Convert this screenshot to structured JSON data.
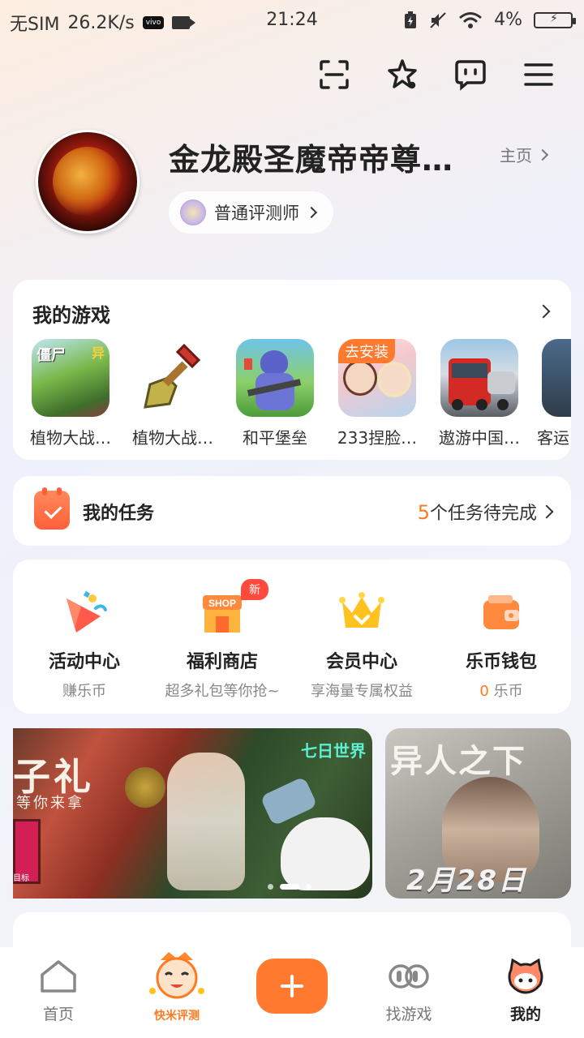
{
  "status_bar": {
    "carrier": "无SIM",
    "speed": "26.2K/s",
    "vivo": "vivo",
    "time": "21:24",
    "battery": "4%"
  },
  "top_icons": [
    "scan-icon",
    "star-icon",
    "message-icon",
    "menu-icon"
  ],
  "profile": {
    "username": "金龙殿圣魔帝帝尊…",
    "home_link": "主页",
    "badge": "普通评测师"
  },
  "my_games": {
    "title": "我的游戏",
    "install_tag": "去安装",
    "items": [
      {
        "name": "植物大战…"
      },
      {
        "name": "植物大战…"
      },
      {
        "name": "和平堡垒"
      },
      {
        "name": "233捏脸…"
      },
      {
        "name": "遨游中国…"
      },
      {
        "name": "客运"
      }
    ]
  },
  "tasks": {
    "title": "我的任务",
    "count": "5",
    "status_suffix": "个任务待完成"
  },
  "functions": {
    "new_tag": "新",
    "items": [
      {
        "title": "活动中心",
        "sub": "赚乐币"
      },
      {
        "title": "福利商店",
        "sub": "超多礼包等你抢~"
      },
      {
        "title": "会员中心",
        "sub": "享海量专属权益"
      },
      {
        "title": "乐币钱包",
        "sub_value": "0",
        "sub_unit": "乐币"
      }
    ],
    "shop_text": "SHOP"
  },
  "banners": {
    "main": {
      "title": "子礼",
      "subtitle": "等你来拿",
      "brand": "七日世界",
      "side_text": "目标"
    },
    "side": {
      "title": "异人之下",
      "date": "2月28日"
    }
  },
  "tab_bar": {
    "items": [
      {
        "label": "首页"
      },
      {
        "label": "找游戏"
      },
      {
        "label": "我的"
      }
    ],
    "mascot_text": "快米评测"
  },
  "colors": {
    "accent": "#ff7a2e",
    "task_count": "#ff7a1e",
    "new_tag": "#ff4a3d"
  }
}
